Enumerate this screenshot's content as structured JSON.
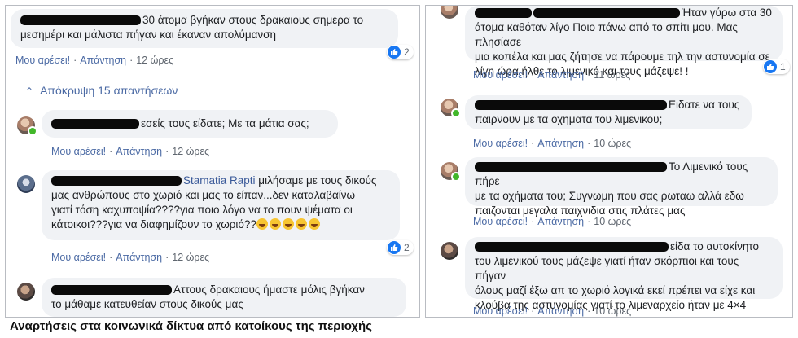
{
  "left_panel": {
    "comment1": {
      "text_line1": "30 άτομα βγήκαν στους δρακαιους σημερα το",
      "text_line2": "μεσημέρι και μάλιστα πήγαν και έκαναν απολύμανση",
      "like": "Μου αρέσει!",
      "reply": "Απάντηση",
      "time": "12 ώρες",
      "reaction_count": "2"
    },
    "hide_replies": "Απόκρυψη 15 απαντήσεων",
    "reply1": {
      "text": "εσείς τους είδατε; Με τα μάτια σας;",
      "like": "Μου αρέσει!",
      "reply": "Απάντηση",
      "time": "12 ώρες"
    },
    "reply2": {
      "mention": "Stamatia Rapti",
      "text_line1": " μιλήσαμε με τους δικούς",
      "text_line2": "μας ανθρώπους στο χωριό και μας το είπαν...δεν καταλαβαίνω",
      "text_line3": "γιατί τόση καχυποψία????για ποιο λόγο να το πουν ψέματα οι",
      "text_line4": "κάτοικοι???για να διαφημίζουν το χωριό??",
      "like": "Μου αρέσει!",
      "reply": "Απάντηση",
      "time": "12 ώρες",
      "reaction_count": "2"
    },
    "reply3": {
      "text_line1": "Αττους δρακαιους ήμαστε μόλις βγήκαν",
      "text_line2": "το μάθαμε κατευθείαν στους δικούς μας"
    }
  },
  "right_panel": {
    "comment1": {
      "text_line1": "Ήταν γύρω στα 30",
      "text_line2": "άτομα καθόταν λίγο Ποιο πάνω από το σπίτι μου. Μας πλησίασε",
      "text_line3": "μια κοπέλα και μας ζήτησε να πάρουμε τηλ την αστυνομία σε",
      "text_line4": "λίγη ώρα ήλθε το λιμενικό και τους μάζεψε! !",
      "like": "Μου αρέσει!",
      "reply": "Απάντηση",
      "time": "11 ώρες",
      "reaction_count": "1"
    },
    "comment2": {
      "text_line1": "Ειδατε να τους",
      "text_line2": "παιρνουν με τα οχηματα του λιμενικου;",
      "like": "Μου αρέσει!",
      "reply": "Απάντηση",
      "time": "10 ώρες"
    },
    "comment3": {
      "text_line1": "Το Λιμενικό τους πήρε",
      "text_line2": "με τα οχήματα του; Συγνωμη που σας ρωταω αλλά εδω",
      "text_line3": "παιζονται μεγαλα παιχνιδια στις πλάτες μας",
      "like": "Μου αρέσει!",
      "reply": "Απάντηση",
      "time": "10 ώρες"
    },
    "comment4": {
      "text_line1": "είδα το αυτοκίνητο",
      "text_line2": "του λιμενικού τους μάζεψε γιατί ήταν σκόρπιοι και τους πήγαν",
      "text_line3": "όλους μαζί έξω απ το χωριό λογικά εκεί πρέπει να είχε και",
      "text_line4": "κλούβα της αστυνομίας γιατί το λιμεναρχείο ήταν με 4×4",
      "like": "Μου αρέσει!",
      "reply": "Απάντηση",
      "time": "10 ώρες"
    }
  },
  "caption": "Αναρτήσεις στα κοινωνικά δίκτυα από κατοίκους της περιοχής",
  "colors": {
    "link": "#4b6aa4",
    "bubble": "#f0f2f5",
    "like_blue": "#1877f2",
    "online": "#42b72a"
  },
  "icons": [
    "like-icon",
    "chevron-up-icon",
    "avatar",
    "online-indicator",
    "laughing-emoji"
  ]
}
